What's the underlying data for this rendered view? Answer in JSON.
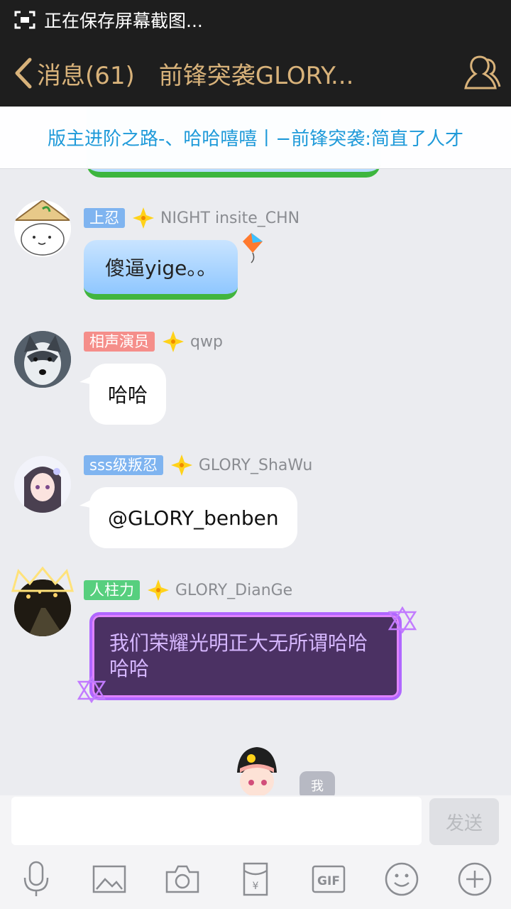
{
  "status_bar": {
    "text": "正在保存屏幕截图..."
  },
  "header": {
    "back_label": "消息(61)",
    "title": "前锋突袭GLORY...",
    "profile_icon": "group-members-icon"
  },
  "announcement": {
    "text": "版主进阶之路-、哈哈嘻嘻丨−前锋突袭:简直了人才"
  },
  "messages": [
    {
      "badge": "上忍",
      "badge_color": "#7fb4f0",
      "star_color": "#ffd21a",
      "username": "NIGHT insite_CHN",
      "text": "傻逼yige。。",
      "style": "blue"
    },
    {
      "badge": "相声演员",
      "badge_color": "#f58e8a",
      "star_color": "#ffd21a",
      "username": "qwp",
      "text": "哈哈",
      "style": "white"
    },
    {
      "badge": "sss级叛忍",
      "badge_color": "#7fb4f0",
      "star_color": "#ffd21a",
      "username": "GLORY_ShaWu",
      "text": "@GLORY_benben",
      "style": "white"
    },
    {
      "badge": "人柱力",
      "badge_color": "#57cf7e",
      "star_color": "#ffd21a",
      "username": "GLORY_DianGe",
      "text": "我们荣耀光明正大无所谓哈哈哈哈",
      "style": "purple"
    }
  ],
  "me_tag": "我",
  "input": {
    "placeholder": "",
    "value": ""
  },
  "send_label": "发送",
  "toolbar": {
    "gif_label": "GIF",
    "currency_label": "¥",
    "icons": [
      "microphone-icon",
      "image-icon",
      "camera-icon",
      "red-packet-icon",
      "gif-icon",
      "emoji-icon",
      "plus-icon"
    ]
  }
}
